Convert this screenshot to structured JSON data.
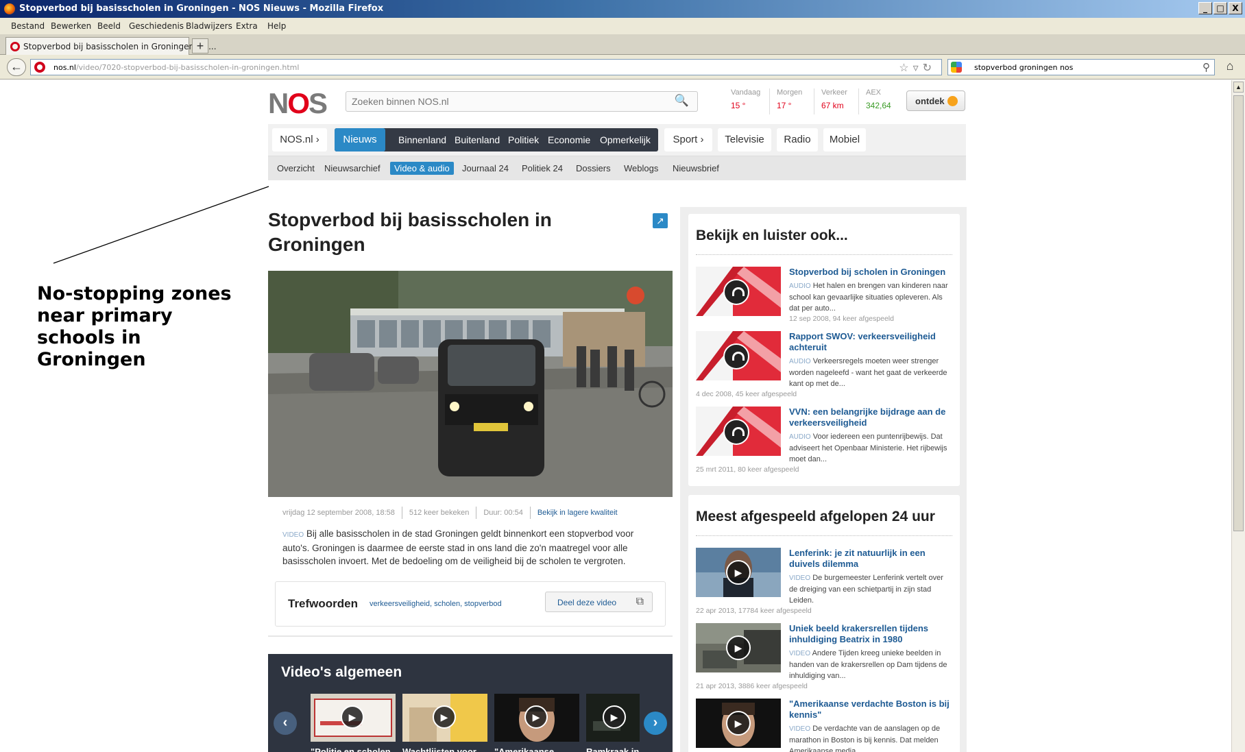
{
  "window": {
    "title": "Stopverbod bij basisscholen in Groningen - NOS Nieuws - Mozilla Firefox",
    "controls": [
      "_",
      "□",
      "X"
    ]
  },
  "menu": [
    "Bestand",
    "Bewerken",
    "Beeld",
    "Geschiedenis",
    "Bladwijzers",
    "Extra",
    "Help"
  ],
  "tab": {
    "label": "Stopverbod bij basisscholen in Groningen - N...",
    "new_tab": "+"
  },
  "address": {
    "domain": "nos.nl",
    "path": "/video/7020-stopverbod-bij-basisscholen-in-groningen.html"
  },
  "browser_search": {
    "value": "stopverbod groningen nos"
  },
  "annotation": "No-stopping zones near primary schools in Groningen",
  "site": {
    "logo_left": "N",
    "logo_o": "O",
    "logo_right": "S",
    "search_placeholder": "Zoeken binnen NOS.nl",
    "info": [
      {
        "label": "Vandaag",
        "value": "15 °",
        "color": "red"
      },
      {
        "label": "Morgen",
        "value": "17 °",
        "color": "red"
      },
      {
        "label": "Verkeer",
        "value": "67 km",
        "color": "red"
      },
      {
        "label": "AEX",
        "value": "342,64",
        "color": "green"
      }
    ],
    "ontdek": "ontdek"
  },
  "mainnav": {
    "home": "NOS.nl",
    "active": "Nieuws",
    "news_items": [
      "Binnenland",
      "Buitenland",
      "Politiek",
      "Economie",
      "Opmerkelijk"
    ],
    "other": [
      "Sport",
      "Televisie",
      "Radio",
      "Mobiel"
    ]
  },
  "subnav": {
    "items": [
      "Overzicht",
      "Nieuwsarchief",
      "Video & audio",
      "Journaal 24",
      "Politiek 24",
      "Dossiers",
      "Weblogs",
      "Nieuwsbrief"
    ],
    "active_index": 2
  },
  "article": {
    "title": "Stopverbod bij basisscholen in Groningen",
    "date": "vrijdag 12 september 2008, 18:58",
    "views": "512 keer bekeken",
    "duration": "Duur: 00:54",
    "quality_link": "Bekijk in lagere kwaliteit",
    "desc_tag": "VIDEO",
    "description": "Bij alle basisscholen in de stad Groningen geldt binnenkort een stopverbod voor auto's. Groningen is daarmee de eerste stad in ons land die zo'n maatregel voor alle basisscholen invoert. Met de bedoeling om de veiligheid bij de scholen te vergroten.",
    "tags_label": "Trefwoorden",
    "tags": "verkeersveiligheid, scholen, stopverbod",
    "share": "Deel deze video"
  },
  "videos": {
    "heading": "Video's algemeen",
    "items": [
      "\"Politie en scholen",
      "Wachtlijsten voor",
      "\"Amerikaanse",
      "Ramkraak in"
    ]
  },
  "sidebar": {
    "also_heading": "Bekijk en luister ook...",
    "also": [
      {
        "title": "Stopverbod bij scholen in Groningen",
        "kind": "AUDIO",
        "desc": "Het halen en brengen van kinderen naar school kan gevaarlijke situaties opleveren. Als dat per auto...",
        "date": "12 sep 2008, 94 keer afgespeeld"
      },
      {
        "title": "Rapport SWOV: verkeersveiligheid achteruit",
        "kind": "AUDIO",
        "desc": "Verkeersregels moeten weer strenger worden nageleefd - want het gaat de verkeerde kant op met de...",
        "date": "4 dec 2008, 45 keer afgespeeld"
      },
      {
        "title": "VVN: een belangrijke bijdrage aan de verkeersveiligheid",
        "kind": "AUDIO",
        "desc": "Voor iedereen een puntenrijbewijs. Dat adviseert het Openbaar Ministerie. Het rijbewijs moet dan...",
        "date": "25 mrt 2011, 80 keer afgespeeld"
      }
    ],
    "most_heading": "Meest afgespeeld afgelopen 24 uur",
    "most": [
      {
        "title": "Lenferink: je zit natuurlijk in een duivels dilemma",
        "kind": "VIDEO",
        "desc": "De burgemeester Lenferink vertelt over de dreiging van een schietpartij in zijn stad Leiden.",
        "date": "22 apr 2013, 17784 keer afgespeeld"
      },
      {
        "title": "Uniek beeld krakersrellen tijdens inhuldiging Beatrix in 1980",
        "kind": "VIDEO",
        "desc": "Andere Tijden kreeg unieke beelden in handen van de krakersrellen op Dam tijdens de inhuldiging van...",
        "date": "21 apr 2013, 3886 keer afgespeeld"
      },
      {
        "title": "\"Amerikaanse verdachte Boston is bij kennis\"",
        "kind": "VIDEO",
        "desc": "De verdachte van de aanslagen op de marathon in Boston is bij kennis. Dat melden Amerikaanse media...",
        "date": ""
      }
    ]
  }
}
